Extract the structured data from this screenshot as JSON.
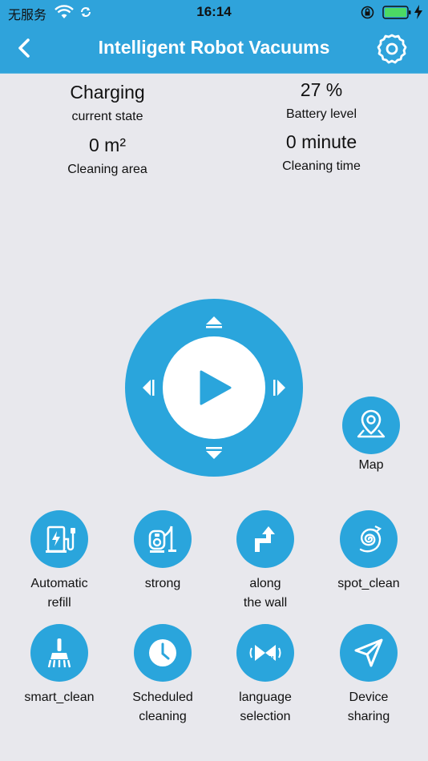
{
  "status_bar": {
    "carrier": "无服务",
    "time": "16:14"
  },
  "header": {
    "title": "Intelligent Robot Vacuums",
    "back_icon": "chevron-left-icon",
    "settings_icon": "gear-icon"
  },
  "stats": {
    "current_state": {
      "value": "Charging",
      "label": "current state"
    },
    "battery": {
      "value": "27 %",
      "label": "Battery level"
    },
    "area": {
      "value": "0 m²",
      "label": "Cleaning area"
    },
    "time": {
      "value": "0 minute",
      "label": "Cleaning time"
    }
  },
  "control": {
    "play_icon": "play-icon"
  },
  "map": {
    "label": "Map",
    "icon": "map-pin-icon"
  },
  "features": [
    {
      "label": "Automatic\nrefill",
      "icon": "charging-station-icon"
    },
    {
      "label": "strong",
      "icon": "vacuum-icon"
    },
    {
      "label": "along\nthe wall",
      "icon": "turn-arrow-icon"
    },
    {
      "label": "spot_clean",
      "icon": "spiral-icon"
    },
    {
      "label": "smart_clean",
      "icon": "broom-icon"
    },
    {
      "label": "Scheduled\ncleaning",
      "icon": "clock-icon"
    },
    {
      "label": "language\nselection",
      "icon": "language-icon"
    },
    {
      "label": "Device\nsharing",
      "icon": "send-icon"
    }
  ],
  "colors": {
    "accent": "#2aa5dc",
    "header": "#2fa3db",
    "background": "#e8e8ed"
  }
}
